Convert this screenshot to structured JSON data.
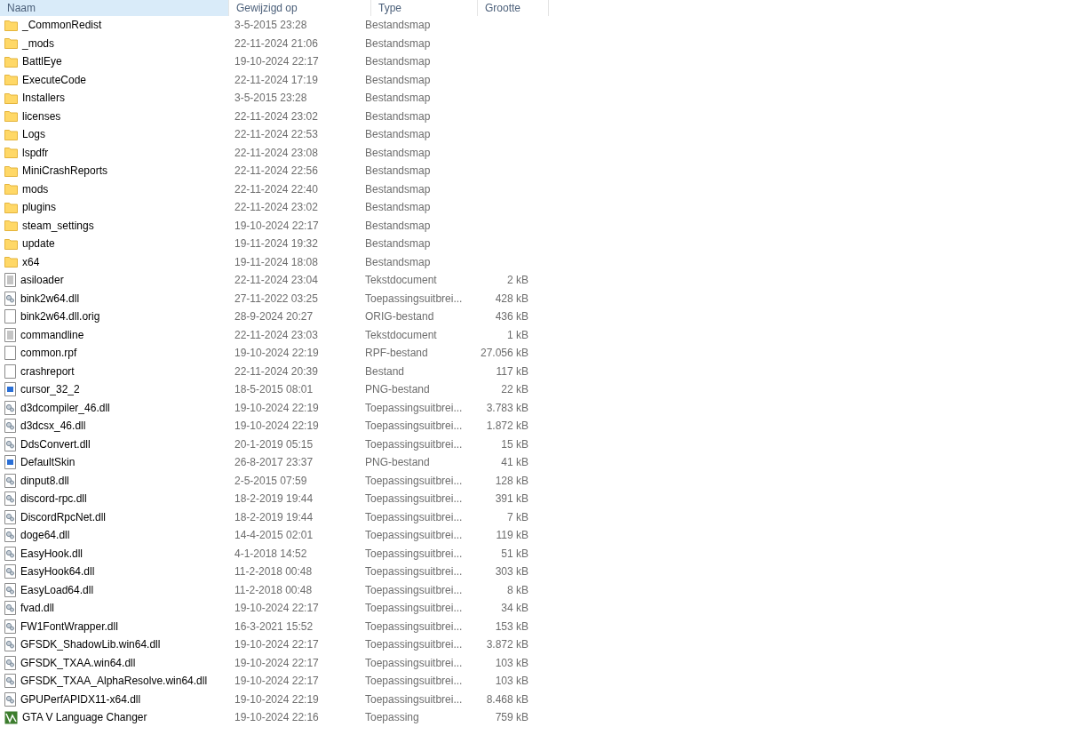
{
  "columns": [
    {
      "label": "Naam",
      "selected": true
    },
    {
      "label": "Gewijzigd op",
      "selected": false
    },
    {
      "label": "Type",
      "selected": false
    },
    {
      "label": "Grootte",
      "selected": false
    }
  ],
  "rows": [
    {
      "kind": "folder",
      "name": "_CommonRedist",
      "modified": "3-5-2015 23:28",
      "type": "Bestandsmap"
    },
    {
      "kind": "folder",
      "name": "_mods",
      "modified": "22-11-2024 21:06",
      "type": "Bestandsmap"
    },
    {
      "kind": "folder",
      "name": "BattlEye",
      "modified": "19-10-2024 22:17",
      "type": "Bestandsmap"
    },
    {
      "kind": "folder",
      "name": "ExecuteCode",
      "modified": "22-11-2024 17:19",
      "type": "Bestandsmap"
    },
    {
      "kind": "folder",
      "name": "Installers",
      "modified": "3-5-2015 23:28",
      "type": "Bestandsmap"
    },
    {
      "kind": "folder",
      "name": "licenses",
      "modified": "22-11-2024 23:02",
      "type": "Bestandsmap"
    },
    {
      "kind": "folder",
      "name": "Logs",
      "modified": "22-11-2024 22:53",
      "type": "Bestandsmap"
    },
    {
      "kind": "folder",
      "name": "lspdfr",
      "modified": "22-11-2024 23:08",
      "type": "Bestandsmap"
    },
    {
      "kind": "folder",
      "name": "MiniCrashReports",
      "modified": "22-11-2024 22:56",
      "type": "Bestandsmap"
    },
    {
      "kind": "folder",
      "name": "mods",
      "modified": "22-11-2024 22:40",
      "type": "Bestandsmap"
    },
    {
      "kind": "folder",
      "name": "plugins",
      "modified": "22-11-2024 23:02",
      "type": "Bestandsmap"
    },
    {
      "kind": "folder",
      "name": "steam_settings",
      "modified": "19-10-2024 22:17",
      "type": "Bestandsmap"
    },
    {
      "kind": "folder",
      "name": "update",
      "modified": "19-11-2024 19:32",
      "type": "Bestandsmap"
    },
    {
      "kind": "folder",
      "name": "x64",
      "modified": "19-11-2024 18:08",
      "type": "Bestandsmap"
    },
    {
      "kind": "text",
      "name": "asiloader",
      "modified": "22-11-2024 23:04",
      "type": "Tekstdocument",
      "size": "2 kB"
    },
    {
      "kind": "dll",
      "name": "bink2w64.dll",
      "modified": "27-11-2022 03:25",
      "type": "Toepassingsuitbrei...",
      "size": "428 kB"
    },
    {
      "kind": "blank",
      "name": "bink2w64.dll.orig",
      "modified": "28-9-2024 20:27",
      "type": "ORIG-bestand",
      "size": "436 kB"
    },
    {
      "kind": "text",
      "name": "commandline",
      "modified": "22-11-2024 23:03",
      "type": "Tekstdocument",
      "size": "1 kB"
    },
    {
      "kind": "blank",
      "name": "common.rpf",
      "modified": "19-10-2024 22:19",
      "type": "RPF-bestand",
      "size": "27.056 kB"
    },
    {
      "kind": "blank",
      "name": "crashreport",
      "modified": "22-11-2024 20:39",
      "type": "Bestand",
      "size": "117 kB"
    },
    {
      "kind": "image",
      "name": "cursor_32_2",
      "modified": "18-5-2015 08:01",
      "type": "PNG-bestand",
      "size": "22 kB"
    },
    {
      "kind": "dll",
      "name": "d3dcompiler_46.dll",
      "modified": "19-10-2024 22:19",
      "type": "Toepassingsuitbrei...",
      "size": "3.783 kB"
    },
    {
      "kind": "dll",
      "name": "d3dcsx_46.dll",
      "modified": "19-10-2024 22:19",
      "type": "Toepassingsuitbrei...",
      "size": "1.872 kB"
    },
    {
      "kind": "dll",
      "name": "DdsConvert.dll",
      "modified": "20-1-2019 05:15",
      "type": "Toepassingsuitbrei...",
      "size": "15 kB"
    },
    {
      "kind": "image",
      "name": "DefaultSkin",
      "modified": "26-8-2017 23:37",
      "type": "PNG-bestand",
      "size": "41 kB"
    },
    {
      "kind": "dll",
      "name": "dinput8.dll",
      "modified": "2-5-2015 07:59",
      "type": "Toepassingsuitbrei...",
      "size": "128 kB"
    },
    {
      "kind": "dll",
      "name": "discord-rpc.dll",
      "modified": "18-2-2019 19:44",
      "type": "Toepassingsuitbrei...",
      "size": "391 kB"
    },
    {
      "kind": "dll",
      "name": "DiscordRpcNet.dll",
      "modified": "18-2-2019 19:44",
      "type": "Toepassingsuitbrei...",
      "size": "7 kB"
    },
    {
      "kind": "dll",
      "name": "doge64.dll",
      "modified": "14-4-2015 02:01",
      "type": "Toepassingsuitbrei...",
      "size": "119 kB"
    },
    {
      "kind": "dll",
      "name": "EasyHook.dll",
      "modified": "4-1-2018 14:52",
      "type": "Toepassingsuitbrei...",
      "size": "51 kB"
    },
    {
      "kind": "dll",
      "name": "EasyHook64.dll",
      "modified": "11-2-2018 00:48",
      "type": "Toepassingsuitbrei...",
      "size": "303 kB"
    },
    {
      "kind": "dll",
      "name": "EasyLoad64.dll",
      "modified": "11-2-2018 00:48",
      "type": "Toepassingsuitbrei...",
      "size": "8 kB"
    },
    {
      "kind": "dll",
      "name": "fvad.dll",
      "modified": "19-10-2024 22:17",
      "type": "Toepassingsuitbrei...",
      "size": "34 kB"
    },
    {
      "kind": "dll",
      "name": "FW1FontWrapper.dll",
      "modified": "16-3-2021 15:52",
      "type": "Toepassingsuitbrei...",
      "size": "153 kB"
    },
    {
      "kind": "dll",
      "name": "GFSDK_ShadowLib.win64.dll",
      "modified": "19-10-2024 22:17",
      "type": "Toepassingsuitbrei...",
      "size": "3.872 kB"
    },
    {
      "kind": "dll",
      "name": "GFSDK_TXAA.win64.dll",
      "modified": "19-10-2024 22:17",
      "type": "Toepassingsuitbrei...",
      "size": "103 kB"
    },
    {
      "kind": "dll",
      "name": "GFSDK_TXAA_AlphaResolve.win64.dll",
      "modified": "19-10-2024 22:17",
      "type": "Toepassingsuitbrei...",
      "size": "103 kB"
    },
    {
      "kind": "dll",
      "name": "GPUPerfAPIDX11-x64.dll",
      "modified": "19-10-2024 22:19",
      "type": "Toepassingsuitbrei...",
      "size": "8.468 kB"
    },
    {
      "kind": "app",
      "name": "GTA V Language Changer",
      "modified": "19-10-2024 22:16",
      "type": "Toepassing",
      "size": "759 kB"
    }
  ]
}
